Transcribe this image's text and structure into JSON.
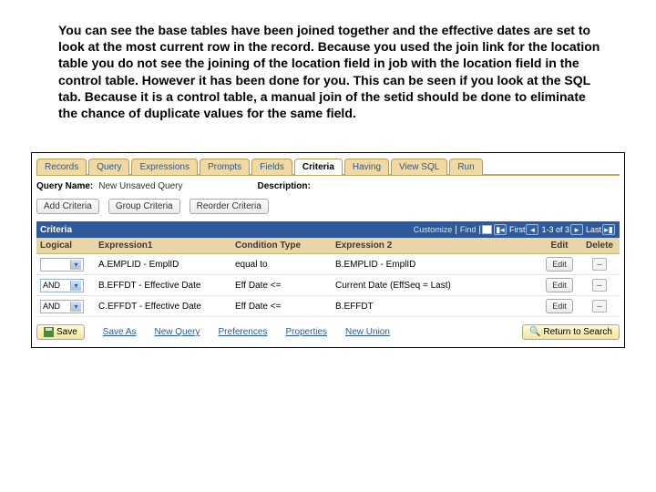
{
  "intro_text": "You can see the base tables have been joined together and the effective dates are set to look at the most current row in the record. Because you used the join link for the location table you do not see the joining of the location field in job with the location field in the control table. However it has been done for you. This can be seen if you look at the SQL tab. Because it is a control table, a manual join of the setid should be done to eliminate the chance of duplicate values for the same field.",
  "tabs": {
    "items": [
      {
        "label": "Records"
      },
      {
        "label": "Query"
      },
      {
        "label": "Expressions"
      },
      {
        "label": "Prompts"
      },
      {
        "label": "Fields"
      },
      {
        "label": "Criteria"
      },
      {
        "label": "Having"
      },
      {
        "label": "View SQL"
      },
      {
        "label": "Run"
      }
    ],
    "active_index": 5
  },
  "query_info": {
    "name_label": "Query Name:",
    "name_value": "New Unsaved Query",
    "desc_label": "Description:"
  },
  "action_buttons": {
    "add": "Add Criteria",
    "group": "Group Criteria",
    "reorder": "Reorder Criteria"
  },
  "grid": {
    "title": "Criteria",
    "toolbar": {
      "customize": "Customize",
      "find": "Find",
      "first": "First",
      "range": "1-3 of 3",
      "last": "Last"
    },
    "headers": {
      "logical": "Logical",
      "exp1": "Expression1",
      "cond": "Condition Type",
      "exp2": "Expression 2",
      "edit": "Edit",
      "del": "Delete"
    },
    "rows": [
      {
        "logical": "",
        "exp1": "A.EMPLID - EmplID",
        "cond": "equal to",
        "exp2": "B.EMPLID - EmplID",
        "edit": "Edit"
      },
      {
        "logical": "AND",
        "exp1": "B.EFFDT - Effective Date",
        "cond": "Eff Date <=",
        "exp2": "Current Date (EffSeq = Last)",
        "edit": "Edit"
      },
      {
        "logical": "AND",
        "exp1": "C.EFFDT - Effective Date",
        "cond": "Eff Date <=",
        "exp2": "B.EFFDT",
        "edit": "Edit"
      }
    ]
  },
  "footer": {
    "save": "Save",
    "save_as": "Save As",
    "new_query": "New Query",
    "preferences": "Preferences",
    "properties": "Properties",
    "new_union": "New Union",
    "return": "Return to Search"
  }
}
